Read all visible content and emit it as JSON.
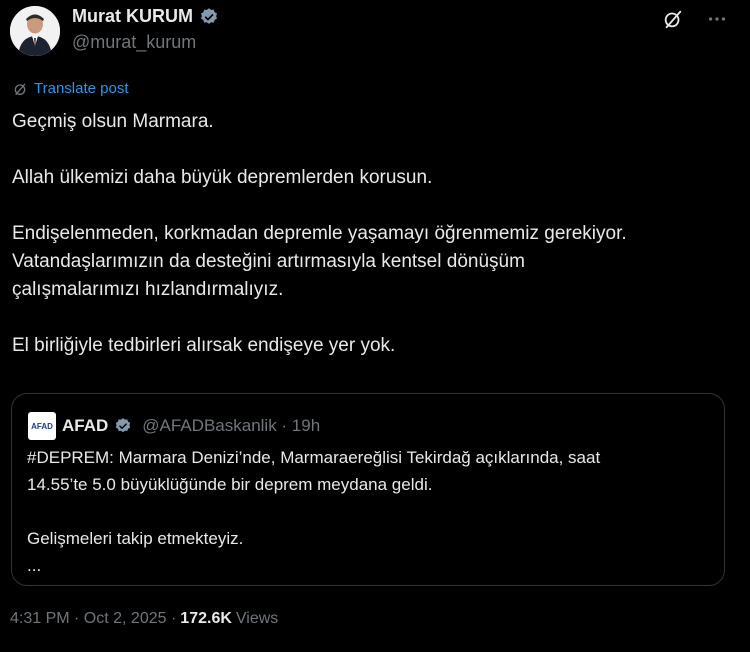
{
  "author": {
    "name": "Murat KURUM",
    "handle": "@murat_kurum"
  },
  "translate_label": "Translate post",
  "post": {
    "p1": "Geçmiş olsun Marmara.",
    "p2": "Allah ülkemizi daha büyük depremlerden korusun.",
    "p3_line1": "Endişelenmeden, korkmadan depremle yaşamayı öğrenmemiz gerekiyor.",
    "p3_line2": "Vatandaşlarımızın da desteğini artırmasıyla kentsel dönüşüm",
    "p3_line3": "çalışmalarımızı hızlandırmalıyız.",
    "p4": "El birliğiyle tedbirleri alırsak endişeye yer yok."
  },
  "quote": {
    "logo_text": "AFAD",
    "name": "AFAD",
    "handle_time": "@AFADBaskanlik · 19h",
    "line1": "#DEPREM: Marmara Denizi’nde, Marmaraereğlisi Tekirdağ açıklarında, saat",
    "line2": "14.55’te 5.0 büyüklüğünde bir deprem meydana geldi.",
    "line3": "Gelişmeleri takip etmekteyiz.",
    "ellipsis": "..."
  },
  "meta": {
    "time_date": "4:31 PM · Oct 2, 2025 ·",
    "views_count": "172.6K",
    "views_label": "Views"
  },
  "colors": {
    "background": "#000000",
    "text": "#e7e9ea",
    "muted": "#71767b",
    "link": "#1d9bf0",
    "verified": "#829aab"
  },
  "icons": {
    "verified": "verified-badge-icon",
    "grok": "grok-icon",
    "more": "more-icon",
    "translate": "translate-icon"
  }
}
